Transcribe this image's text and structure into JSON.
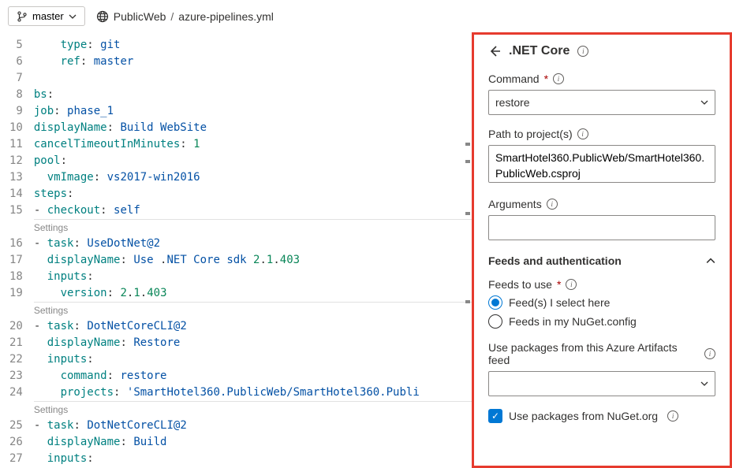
{
  "header": {
    "branch": "master",
    "breadcrumb_root": "PublicWeb",
    "breadcrumb_file": "azure-pipelines.yml"
  },
  "editor": {
    "settings_label": "Settings",
    "lines": [
      {
        "n": 5,
        "html": "    <span class='k'>type</span><span class='c'>:</span> <span class='s'>git</span>"
      },
      {
        "n": 6,
        "html": "    <span class='k'>ref</span><span class='c'>:</span> <span class='s'>master</span>"
      },
      {
        "n": 7,
        "html": ""
      },
      {
        "n": 8,
        "html": "<span class='k'>bs</span><span class='c'>:</span>"
      },
      {
        "n": 9,
        "html": "<span class='k'>job</span><span class='c'>:</span> <span class='s'>phase_1</span>"
      },
      {
        "n": 10,
        "html": "<span class='k'>displayName</span><span class='c'>:</span> <span class='s'>Build WebSite</span>"
      },
      {
        "n": 11,
        "html": "<span class='k'>cancelTimeoutInMinutes</span><span class='c'>:</span> <span class='n'>1</span>"
      },
      {
        "n": 12,
        "html": "<span class='k'>pool</span><span class='c'>:</span>"
      },
      {
        "n": 13,
        "html": "  <span class='k'>vmImage</span><span class='c'>:</span> <span class='s'>vs2017-win2016</span>"
      },
      {
        "n": 14,
        "html": "<span class='k'>steps</span><span class='c'>:</span>"
      },
      {
        "n": 15,
        "html": "<span class='c'>- </span><span class='k'>checkout</span><span class='c'>:</span> <span class='s'>self</span>"
      },
      {
        "settings": true
      },
      {
        "n": 16,
        "html": "<span class='c'>- </span><span class='k'>task</span><span class='c'>:</span> <span class='s'>UseDotNet</span><span class='at'>@2</span>"
      },
      {
        "n": 17,
        "html": "  <span class='k'>displayName</span><span class='c'>:</span> <span class='s'>Use </span><span class='dot'>.</span><span class='s'>NET Core sdk </span><span class='n'>2</span><span class='dot'>.</span><span class='n'>1</span><span class='dot'>.</span><span class='n'>403</span>"
      },
      {
        "n": 18,
        "html": "  <span class='k'>inputs</span><span class='c'>:</span>"
      },
      {
        "n": 19,
        "html": "    <span class='k'>version</span><span class='c'>:</span> <span class='n'>2</span><span class='dot'>.</span><span class='n'>1</span><span class='dot'>.</span><span class='n'>403</span>"
      },
      {
        "settings": true
      },
      {
        "n": 20,
        "html": "<span class='c'>- </span><span class='k'>task</span><span class='c'>:</span> <span class='s'>DotNetCoreCLI</span><span class='at'>@2</span>"
      },
      {
        "n": 21,
        "html": "  <span class='k'>displayName</span><span class='c'>:</span> <span class='s'>Restore</span>"
      },
      {
        "n": 22,
        "html": "  <span class='k'>inputs</span><span class='c'>:</span>"
      },
      {
        "n": 23,
        "html": "    <span class='k'>command</span><span class='c'>:</span> <span class='s'>restore</span>"
      },
      {
        "n": 24,
        "html": "    <span class='k'>projects</span><span class='c'>:</span> <span class='s'>'SmartHotel360.PublicWeb/SmartHotel360.Publi</span>"
      },
      {
        "settings": true
      },
      {
        "n": 25,
        "html": "<span class='c'>- </span><span class='k'>task</span><span class='c'>:</span> <span class='s'>DotNetCoreCLI</span><span class='at'>@2</span>"
      },
      {
        "n": 26,
        "html": "  <span class='k'>displayName</span><span class='c'>:</span> <span class='s'>Build</span>"
      },
      {
        "n": 27,
        "html": "  <span class='k'>inputs</span><span class='c'>:</span>"
      }
    ]
  },
  "panel": {
    "title": ".NET Core",
    "command_label": "Command",
    "command_value": "restore",
    "path_label": "Path to project(s)",
    "path_value": "SmartHotel360.PublicWeb/SmartHotel360.PublicWeb.csproj",
    "args_label": "Arguments",
    "args_value": "",
    "feeds_section": "Feeds and authentication",
    "feeds_to_use_label": "Feeds to use",
    "radio_select_here": "Feed(s) I select here",
    "radio_nuget_config": "Feeds in my NuGet.config",
    "artifacts_label": "Use packages from this Azure Artifacts feed",
    "artifacts_value": "",
    "nuget_checkbox": "Use packages from NuGet.org"
  }
}
